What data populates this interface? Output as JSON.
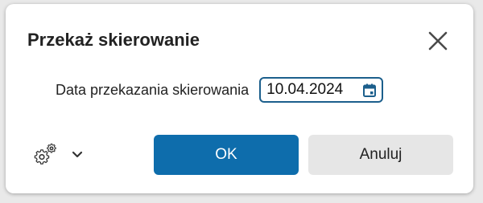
{
  "dialog": {
    "title": "Przekaż skierowanie",
    "close_icon": "close-icon"
  },
  "date_field": {
    "label": "Data przekazania skierowania",
    "value": "10.04.2024",
    "icon": "calendar-icon"
  },
  "footer": {
    "settings_icon": "gear-icon",
    "dropdown_icon": "chevron-down-icon",
    "ok_label": "OK",
    "cancel_label": "Anuluj"
  },
  "colors": {
    "primary": "#0e6dac",
    "input_border": "#1c5f8c",
    "cancel_bg": "#e6e6e6",
    "text": "#222222"
  }
}
